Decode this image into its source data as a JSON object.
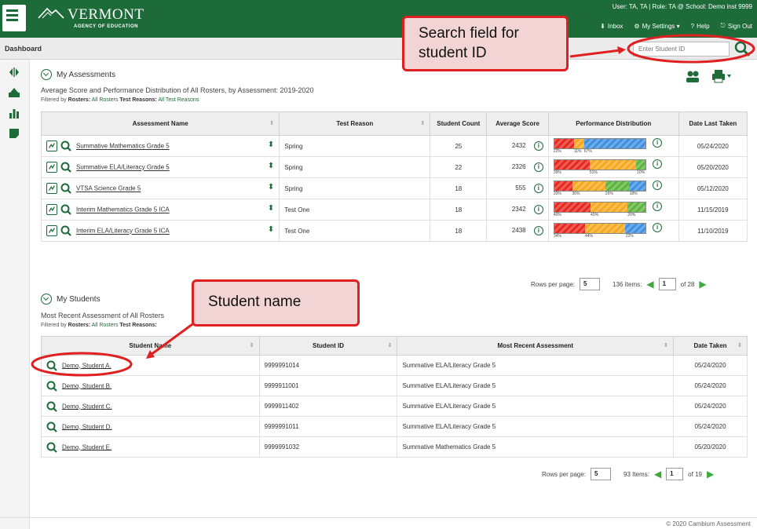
{
  "header": {
    "brand_title": "VERMONT",
    "brand_subtitle": "AGENCY OF EDUCATION",
    "user_info": "User: TA, TA | Role: TA @ School: Demo inst 9999",
    "links": {
      "inbox": "Inbox",
      "settings": "My Settings ▾",
      "help": "Help",
      "signout": "Sign Out"
    }
  },
  "subbar": {
    "title": "Dashboard",
    "search_placeholder": "Enter Student ID"
  },
  "assessments": {
    "title": "My Assessments",
    "description": "Average Score and Performance Distribution of All Rosters, by Assessment: 2019-2020",
    "filter": {
      "prefix": "Filtered by",
      "rosters_label": "Rosters:",
      "rosters_value": "All Rosters",
      "reasons_label": "Test Reasons:",
      "reasons_value": "All Test Reasons"
    },
    "columns": {
      "name": "Assessment Name",
      "reason": "Test Reason",
      "count": "Student Count",
      "score": "Average Score",
      "perf": "Performance Distribution",
      "date": "Date Last Taken"
    },
    "rows": [
      {
        "name": "Summative Mathematics Grade 5",
        "reason": "Spring",
        "count": "25",
        "score": "2432",
        "date": "05/24/2020",
        "dist": [
          22,
          11,
          0,
          67
        ],
        "labels": [
          "22%",
          "11%",
          "",
          "67%"
        ]
      },
      {
        "name": "Summative ELA/Literacy Grade 5",
        "reason": "Spring",
        "count": "22",
        "score": "2326",
        "date": "05/20/2020",
        "dist": [
          39,
          51,
          10,
          0
        ],
        "labels": [
          "39%",
          "51%",
          "10%",
          ""
        ]
      },
      {
        "name": "VTSA Science Grade 5",
        "reason": "Spring",
        "count": "18",
        "score": "555",
        "date": "05/12/2020",
        "dist": [
          20,
          36,
          26,
          18
        ],
        "labels": [
          "20%",
          "36%",
          "26%",
          "18%"
        ]
      },
      {
        "name": "Interim Mathematics Grade 5 ICA",
        "reason": "Test One",
        "count": "18",
        "score": "2342",
        "date": "11/15/2019",
        "dist": [
          40,
          40,
          20,
          0
        ],
        "labels": [
          "40%",
          "40%",
          "20%",
          ""
        ]
      },
      {
        "name": "Interim ELA/Literacy Grade 5 ICA",
        "reason": "Test One",
        "count": "18",
        "score": "2438",
        "date": "11/10/2019",
        "dist": [
          34,
          44,
          0,
          22
        ],
        "labels": [
          "34%",
          "44%",
          "",
          "22%"
        ]
      }
    ],
    "pager": {
      "rows_label": "Rows per page:",
      "rows_value": "5",
      "items": "136 Items:",
      "page": "1",
      "of": "of 28"
    }
  },
  "students": {
    "title": "My Students",
    "description": "Most Recent Assessment of All Rosters",
    "filter": {
      "prefix": "Filtered by",
      "rosters_label": "Rosters:",
      "rosters_value": "All Rosters",
      "reasons_label": "Test Reasons:"
    },
    "columns": {
      "name": "Student Name",
      "id": "Student ID",
      "recent": "Most Recent Assessment",
      "date": "Date Taken"
    },
    "rows": [
      {
        "name": "Demo, Student A.",
        "id": "9999991014",
        "recent": "Summative ELA/Literacy Grade 5",
        "date": "05/24/2020"
      },
      {
        "name": "Demo, Student B.",
        "id": "9999911001",
        "recent": "Summative ELA/Literacy Grade 5",
        "date": "05/24/2020"
      },
      {
        "name": "Demo, Student C.",
        "id": "9999911402",
        "recent": "Summative ELA/Literacy Grade 5",
        "date": "05/24/2020"
      },
      {
        "name": "Demo, Student D.",
        "id": "9999991011",
        "recent": "Summative ELA/Literacy Grade 5",
        "date": "05/24/2020"
      },
      {
        "name": "Demo, Student E.",
        "id": "9999991032",
        "recent": "Summative Mathematics Grade 5",
        "date": "05/20/2020"
      }
    ],
    "pager": {
      "rows_label": "Rows per page:",
      "rows_value": "5",
      "items": "93 Items:",
      "page": "1",
      "of": "of 19"
    }
  },
  "callouts": {
    "search": "Search field for student ID",
    "student": "Student name"
  },
  "footer": "© 2020 Cambium Assessment",
  "colors": {
    "brand": "#1e6b3a",
    "level1": "#e8261e",
    "level2": "#f5a81c",
    "level3": "#5bb53a",
    "level4": "#3d8fe0",
    "callout_border": "#e02020",
    "callout_fill": "#f2d4d4"
  }
}
